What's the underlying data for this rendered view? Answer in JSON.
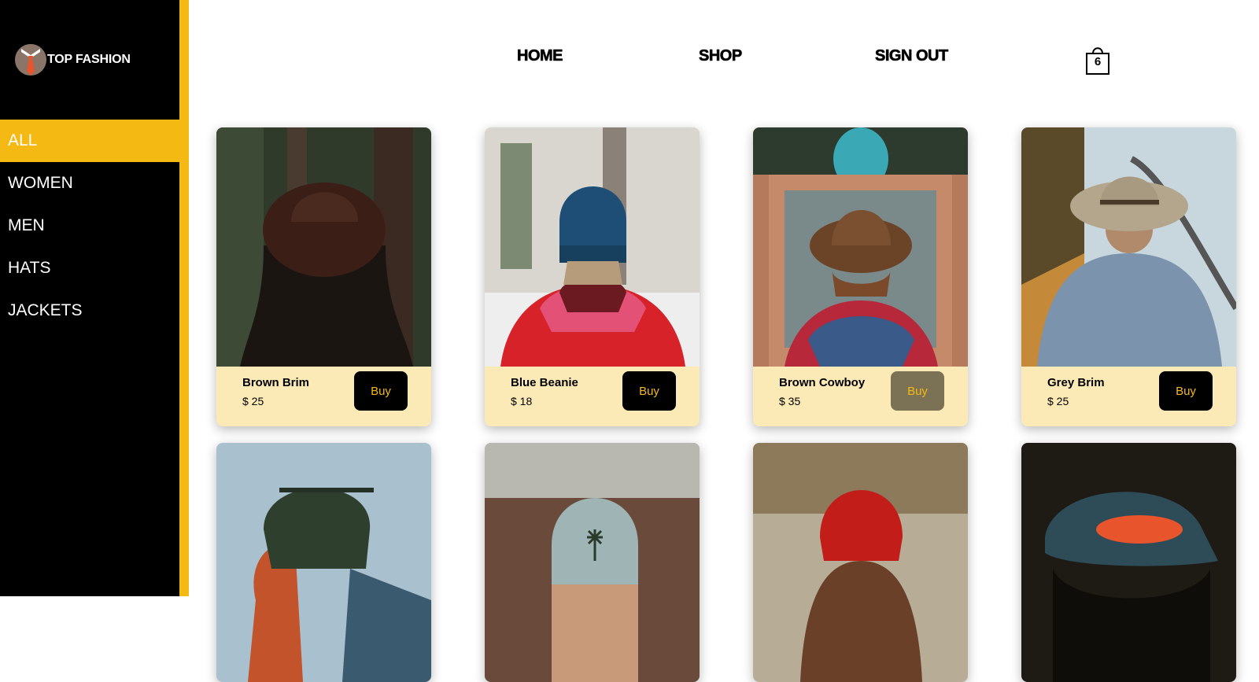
{
  "brand": {
    "name": "TOP FASHION"
  },
  "sidebar": {
    "items": [
      {
        "label": "ALL"
      },
      {
        "label": "WOMEN"
      },
      {
        "label": "MEN"
      },
      {
        "label": "HATS"
      },
      {
        "label": "JACKETS"
      }
    ],
    "active_index": 0
  },
  "nav": {
    "home": "HOME",
    "shop": "SHOP",
    "sign_out": "SIGN OUT",
    "cart_count": "6"
  },
  "products": [
    {
      "name": "Brown Brim",
      "price": "$ 25",
      "buy_label": "Buy"
    },
    {
      "name": "Blue Beanie",
      "price": "$ 18",
      "buy_label": "Buy"
    },
    {
      "name": "Brown Cowboy",
      "price": "$ 35",
      "buy_label": "Buy"
    },
    {
      "name": "Grey Brim",
      "price": "$ 25",
      "buy_label": "Buy"
    },
    {
      "name": "",
      "price": "",
      "buy_label": ""
    },
    {
      "name": "",
      "price": "",
      "buy_label": ""
    },
    {
      "name": "",
      "price": "",
      "buy_label": ""
    },
    {
      "name": "",
      "price": "",
      "buy_label": ""
    }
  ],
  "colors": {
    "accent": "#f5b913",
    "sidebar_bg": "#000000",
    "card_bg": "#fbe9b6",
    "buy_bg": "#000000",
    "buy_hover_bg": "#7b7256"
  },
  "icons": {
    "logo": "tie-logo-icon",
    "cart": "shopping-bag-icon"
  }
}
